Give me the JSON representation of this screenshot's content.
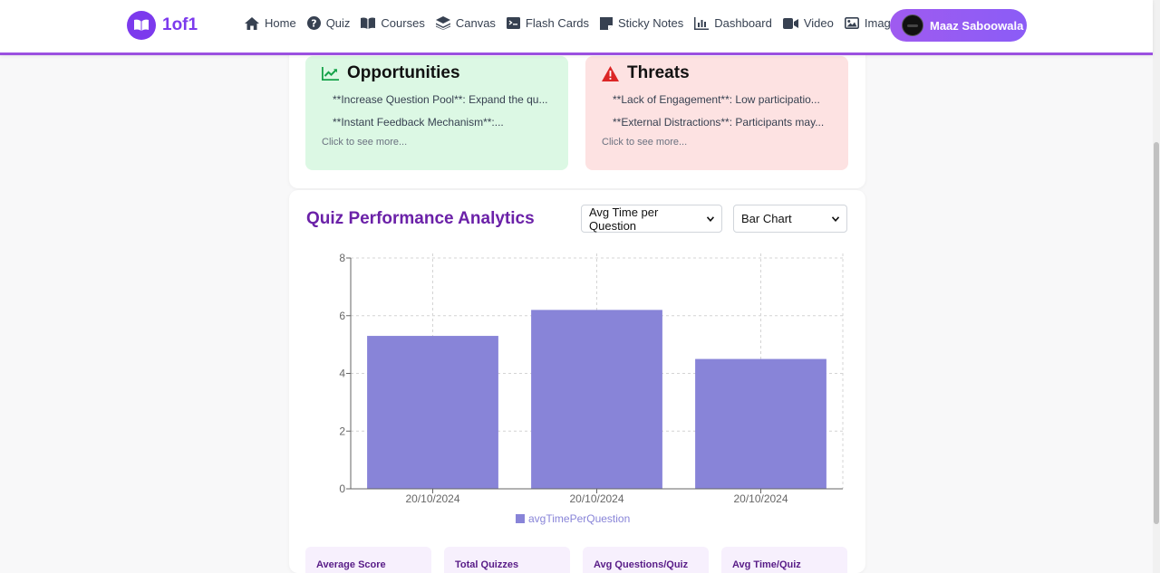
{
  "brand": {
    "name": "1of1",
    "logo_icon": "book-open-icon",
    "accent": "#7c3aed"
  },
  "nav": {
    "items": [
      {
        "label": "Home",
        "icon": "home-icon"
      },
      {
        "label": "Quiz",
        "icon": "question-circle-icon"
      },
      {
        "label": "Courses",
        "icon": "book-icon"
      },
      {
        "label": "Canvas",
        "icon": "layers-icon"
      },
      {
        "label": "Flash Cards",
        "icon": "terminal-card-icon"
      },
      {
        "label": "Sticky Notes",
        "icon": "sticky-note-icon"
      },
      {
        "label": "Dashboard",
        "icon": "bar-chart-icon"
      },
      {
        "label": "Video",
        "icon": "video-icon"
      },
      {
        "label": "Image",
        "icon": "image-icon"
      }
    ],
    "user": {
      "name": "Maaz Saboowala"
    }
  },
  "swot": {
    "opportunities": {
      "title": "Opportunities",
      "icon": "trend-up-icon",
      "lines": [
        "**Increase Question Pool**: Expand the qu...",
        "**Instant Feedback Mechanism**:..."
      ],
      "more": "Click to see more...",
      "color": "#dcf8e4"
    },
    "threats": {
      "title": "Threats",
      "icon": "warning-icon",
      "lines": [
        "**Lack of Engagement**: Low participatio...",
        "**External Distractions**: Participants may..."
      ],
      "more": "Click to see more...",
      "color": "#fde2e2"
    }
  },
  "analytics": {
    "title": "Quiz Performance Analytics",
    "metric_select": "Avg Time per Question",
    "chart_type_select": "Bar Chart"
  },
  "chart_data": {
    "type": "bar",
    "categories": [
      "20/10/2024",
      "20/10/2024",
      "20/10/2024"
    ],
    "series": [
      {
        "name": "avgTimePerQuestion",
        "values": [
          5.3,
          6.2,
          4.5
        ],
        "color": "#8884d8"
      }
    ],
    "ylim": [
      0,
      8
    ],
    "yticks": [
      0,
      2,
      4,
      6,
      8
    ],
    "grid": true,
    "legend": "bottom"
  },
  "stats": [
    {
      "label": "Average Score"
    },
    {
      "label": "Total Quizzes"
    },
    {
      "label": "Avg Questions/Quiz"
    },
    {
      "label": "Avg Time/Quiz"
    }
  ]
}
